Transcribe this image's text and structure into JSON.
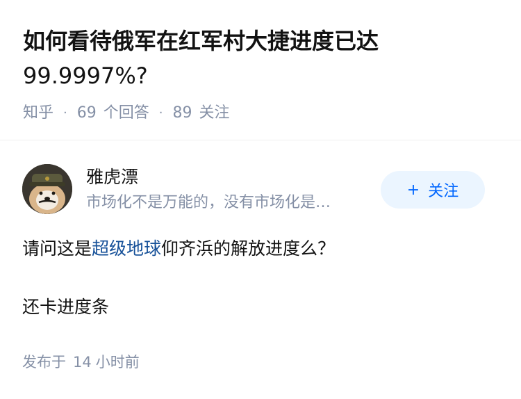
{
  "question": {
    "title_main": "如何看待俄军在红军村大捷进度已达",
    "title_tail": "99.9997%?",
    "source": "知乎",
    "answers_count": "69",
    "answers_label": "个回答",
    "followers_count": "89",
    "followers_label": "关注"
  },
  "author": {
    "name": "雅虎漂",
    "bio": "市场化不是万能的，没有市场化是…",
    "follow_plus": "+",
    "follow_label": "关注"
  },
  "answer": {
    "p1_before": "请问这是",
    "p1_link": "超级地球",
    "p1_after": "仰齐浜的解放进度么？",
    "p2": "还卡进度条"
  },
  "footer": {
    "published_prefix": "发布于",
    "published_num": "14",
    "published_suffix": "小时前"
  },
  "colors": {
    "title": "#121212",
    "meta": "#8590a6",
    "link": "#175199",
    "follow_bg": "#ebf5ff",
    "follow_text": "#0066ff"
  }
}
